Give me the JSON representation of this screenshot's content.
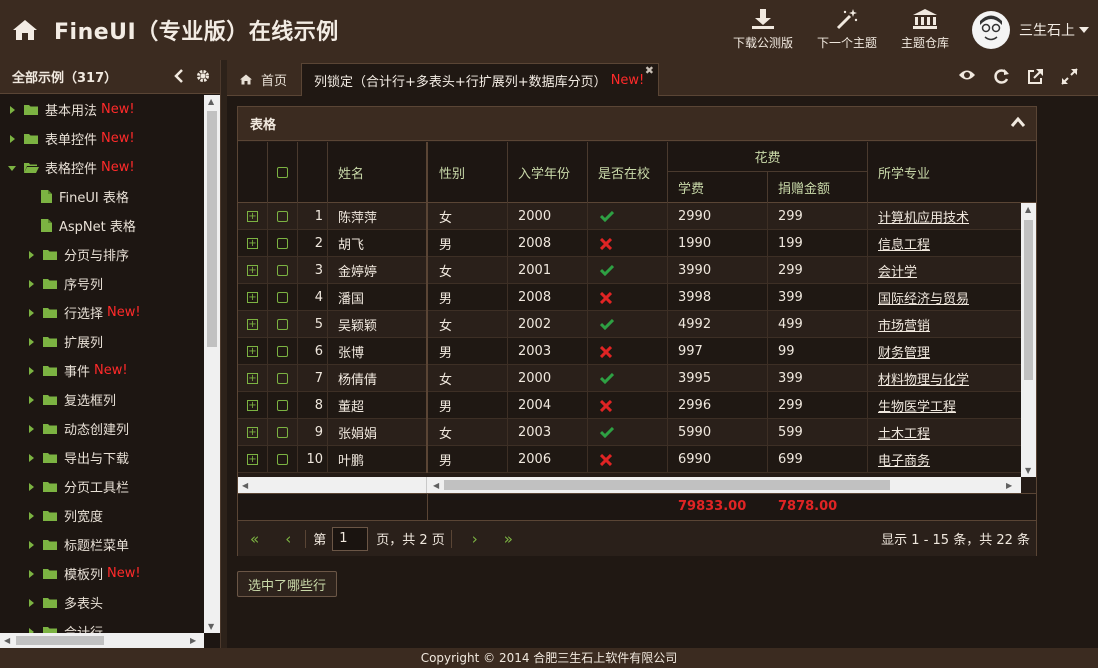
{
  "header": {
    "title": "FineUI（专业版）在线示例",
    "buttons": [
      {
        "label": "下载公测版",
        "icon": "download-icon"
      },
      {
        "label": "下一个主题",
        "icon": "magic-wand-icon"
      },
      {
        "label": "主题仓库",
        "icon": "bank-icon"
      }
    ],
    "user": "三生石上"
  },
  "sidebar": {
    "title": "全部示例（317）",
    "new_label": "New!",
    "items": [
      {
        "label": "基本用法",
        "new": true,
        "level": 0,
        "type": "folder"
      },
      {
        "label": "表单控件",
        "new": true,
        "level": 0,
        "type": "folder"
      },
      {
        "label": "表格控件",
        "new": true,
        "level": 0,
        "type": "folder-open"
      },
      {
        "label": "FineUI 表格",
        "new": false,
        "level": 1,
        "type": "file"
      },
      {
        "label": "AspNet 表格",
        "new": false,
        "level": 1,
        "type": "file"
      },
      {
        "label": "分页与排序",
        "new": false,
        "level": 1,
        "type": "folder"
      },
      {
        "label": "序号列",
        "new": false,
        "level": 1,
        "type": "folder"
      },
      {
        "label": "行选择",
        "new": true,
        "level": 1,
        "type": "folder"
      },
      {
        "label": "扩展列",
        "new": false,
        "level": 1,
        "type": "folder"
      },
      {
        "label": "事件",
        "new": true,
        "level": 1,
        "type": "folder"
      },
      {
        "label": "复选框列",
        "new": false,
        "level": 1,
        "type": "folder"
      },
      {
        "label": "动态创建列",
        "new": false,
        "level": 1,
        "type": "folder"
      },
      {
        "label": "导出与下载",
        "new": false,
        "level": 1,
        "type": "folder"
      },
      {
        "label": "分页工具栏",
        "new": false,
        "level": 1,
        "type": "folder"
      },
      {
        "label": "列宽度",
        "new": false,
        "level": 1,
        "type": "folder"
      },
      {
        "label": "标题栏菜单",
        "new": false,
        "level": 1,
        "type": "folder"
      },
      {
        "label": "模板列",
        "new": true,
        "level": 1,
        "type": "folder"
      },
      {
        "label": "多表头",
        "new": false,
        "level": 1,
        "type": "folder"
      },
      {
        "label": "合计行",
        "new": false,
        "level": 1,
        "type": "folder"
      }
    ]
  },
  "tabs": {
    "home": "首页",
    "active": "列锁定（合计行+多表头+行扩展列+数据库分页）",
    "active_new": "New!"
  },
  "panel": {
    "title": "表格"
  },
  "grid": {
    "headers": {
      "name": "姓名",
      "gender": "性别",
      "year": "入学年份",
      "enrolled": "是否在校",
      "fees_group": "花费",
      "tuition": "学费",
      "donation": "捐赠金额",
      "major": "所学专业"
    },
    "rows": [
      {
        "no": "1",
        "name": "陈萍萍",
        "gender": "女",
        "year": "2000",
        "enrolled": true,
        "tuition": "2990",
        "donation": "299",
        "major": "计算机应用技术"
      },
      {
        "no": "2",
        "name": "胡飞",
        "gender": "男",
        "year": "2008",
        "enrolled": false,
        "tuition": "1990",
        "donation": "199",
        "major": "信息工程"
      },
      {
        "no": "3",
        "name": "金婷婷",
        "gender": "女",
        "year": "2001",
        "enrolled": true,
        "tuition": "3990",
        "donation": "299",
        "major": "会计学"
      },
      {
        "no": "4",
        "name": "潘国",
        "gender": "男",
        "year": "2008",
        "enrolled": false,
        "tuition": "3998",
        "donation": "399",
        "major": "国际经济与贸易"
      },
      {
        "no": "5",
        "name": "吴颖颖",
        "gender": "女",
        "year": "2002",
        "enrolled": true,
        "tuition": "4992",
        "donation": "499",
        "major": "市场营销"
      },
      {
        "no": "6",
        "name": "张博",
        "gender": "男",
        "year": "2003",
        "enrolled": false,
        "tuition": "997",
        "donation": "99",
        "major": "财务管理"
      },
      {
        "no": "7",
        "name": "杨倩倩",
        "gender": "女",
        "year": "2000",
        "enrolled": true,
        "tuition": "3995",
        "donation": "399",
        "major": "材料物理与化学"
      },
      {
        "no": "8",
        "name": "董超",
        "gender": "男",
        "year": "2004",
        "enrolled": false,
        "tuition": "2996",
        "donation": "299",
        "major": "生物医学工程"
      },
      {
        "no": "9",
        "name": "张娟娟",
        "gender": "女",
        "year": "2003",
        "enrolled": true,
        "tuition": "5990",
        "donation": "599",
        "major": "土木工程"
      },
      {
        "no": "10",
        "name": "叶鹏",
        "gender": "男",
        "year": "2006",
        "enrolled": false,
        "tuition": "6990",
        "donation": "699",
        "major": "电子商务"
      }
    ],
    "summary": {
      "tuition": "79833.00",
      "donation": "7878.00"
    }
  },
  "pager": {
    "page_prefix": "第",
    "page_value": "1",
    "page_suffix": "页，共 2 页",
    "info": "显示 1 - 15 条，共 22 条"
  },
  "actions": {
    "selected_rows_button": "选中了哪些行"
  },
  "footer": {
    "copyright": "Copyright © 2014 合肥三生石上软件有限公司"
  },
  "colors": {
    "header_bg": "#3b2b20",
    "accent_green": "#7cb342",
    "new_red": "#ff2a2a",
    "header_text_green": "#c9d9a9",
    "summary_red": "#e02424"
  }
}
